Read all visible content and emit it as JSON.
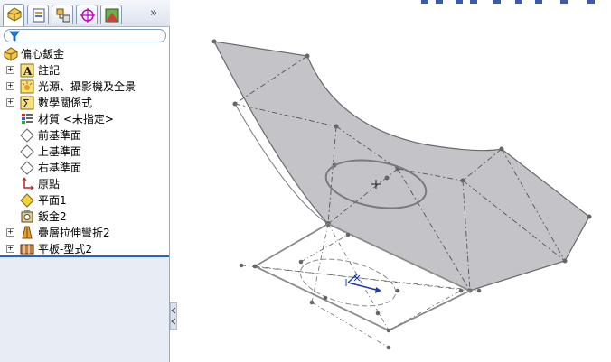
{
  "feature_tree": {
    "filter_icon": "funnel-icon",
    "more_icon": "double-chevron-right-icon",
    "root": {
      "label": "偏心鈑金",
      "icon": "part-icon"
    },
    "items": [
      {
        "label": "註記",
        "icon": "annotations-icon",
        "expandable": true
      },
      {
        "label": "光源、攝影機及全景",
        "icon": "lights-cameras-icon",
        "expandable": true
      },
      {
        "label": "數學關係式",
        "icon": "equations-icon",
        "expandable": true
      },
      {
        "label": "材質 <未指定>",
        "icon": "material-icon",
        "expandable": false
      },
      {
        "label": "前基準面",
        "icon": "plane-icon",
        "expandable": false
      },
      {
        "label": "上基準面",
        "icon": "plane-icon",
        "expandable": false
      },
      {
        "label": "右基準面",
        "icon": "plane-icon",
        "expandable": false
      },
      {
        "label": "原點",
        "icon": "origin-icon",
        "expandable": false
      },
      {
        "label": "平面1",
        "icon": "plane-yellow-icon",
        "expandable": false
      },
      {
        "label": "鈑金2",
        "icon": "sheet-metal-icon",
        "expandable": false
      },
      {
        "label": "疊層拉伸彎折2",
        "icon": "lofted-bend-icon",
        "expandable": true
      },
      {
        "label": "平板-型式2",
        "icon": "flat-pattern-icon",
        "expandable": true
      }
    ],
    "expand_symbol": "+"
  },
  "tabs": [
    {
      "name": "featuremanager-tab",
      "icon": "feature-tree-icon",
      "active": true
    },
    {
      "name": "propertymanager-tab",
      "icon": "property-icon",
      "active": false
    },
    {
      "name": "configurationmanager-tab",
      "icon": "configuration-icon",
      "active": false
    },
    {
      "name": "dimxpert-tab",
      "icon": "target-icon",
      "active": false
    },
    {
      "name": "display-manager-tab",
      "icon": "display-icon",
      "active": false
    }
  ],
  "colors": {
    "surface_fill": "#c4c4c8",
    "edge": "#6a6a6e",
    "sketch": "#7a7a7a",
    "accent_blue": "#2a62c0"
  }
}
